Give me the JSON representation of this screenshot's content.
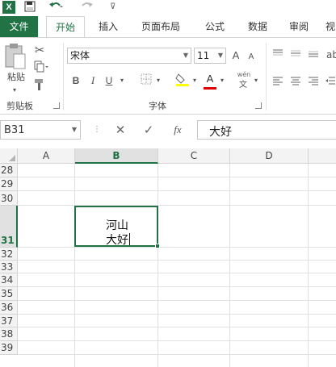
{
  "qat": {
    "logo": "X",
    "save_icon": "save-icon",
    "undo_icon": "undo-icon",
    "redo_icon": "redo-icon"
  },
  "tabs": [
    {
      "label": "文件"
    },
    {
      "label": "开始"
    },
    {
      "label": "插入"
    },
    {
      "label": "页面布局"
    },
    {
      "label": "公式"
    },
    {
      "label": "数据"
    },
    {
      "label": "审阅"
    },
    {
      "label": "视"
    }
  ],
  "ribbon": {
    "clipboard": {
      "paste_label": "粘贴",
      "group_label": "剪贴板"
    },
    "font": {
      "font_name": "宋体",
      "font_size": "11",
      "bold": "B",
      "italic": "I",
      "underline": "U",
      "grow": "A",
      "shrink": "A",
      "font_color": "A",
      "phonetic": "wén",
      "group_label": "字体"
    }
  },
  "formula_bar": {
    "name_box": "B31",
    "cancel": "✕",
    "enter": "✓",
    "fx": "fx",
    "content": "大好"
  },
  "grid": {
    "columns": [
      "A",
      "B",
      "C",
      "D"
    ],
    "selected_column": "B",
    "rows": [
      "28",
      "29",
      "30",
      "31",
      "32",
      "33",
      "34",
      "35",
      "36",
      "37",
      "38",
      "39"
    ],
    "selected_row": "31",
    "active_cell": {
      "ref": "B31",
      "line1": "河山",
      "line2": "大好"
    }
  },
  "colors": {
    "accent": "#217346",
    "font_color_bar": "#e00000",
    "fill_color_bar": "#ffff00"
  }
}
